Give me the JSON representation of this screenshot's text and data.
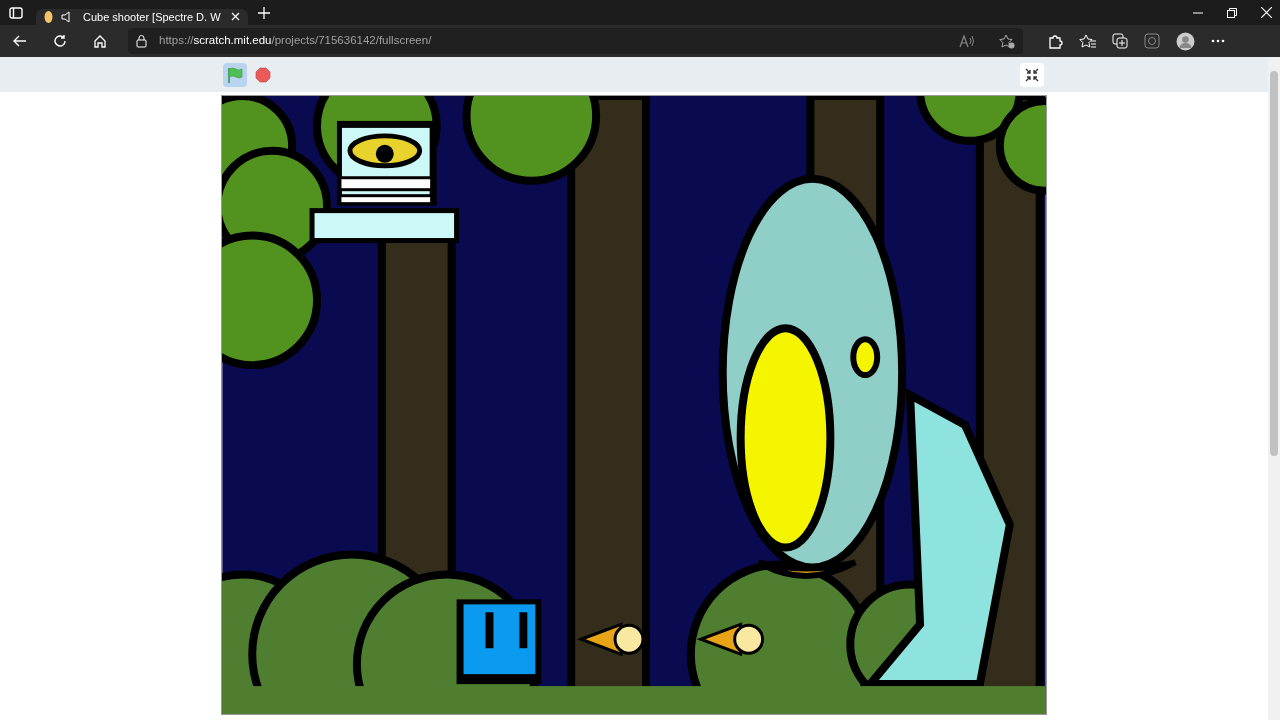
{
  "browser": {
    "tab": {
      "title": "Cube shooter [Spectre D. W",
      "selected": true,
      "audio_playing": true
    },
    "address": {
      "url": "https://**scratch.mit.edu**/projects/715636142/fullscreen/"
    }
  },
  "player": {
    "green_flag": {
      "active": true
    }
  }
}
